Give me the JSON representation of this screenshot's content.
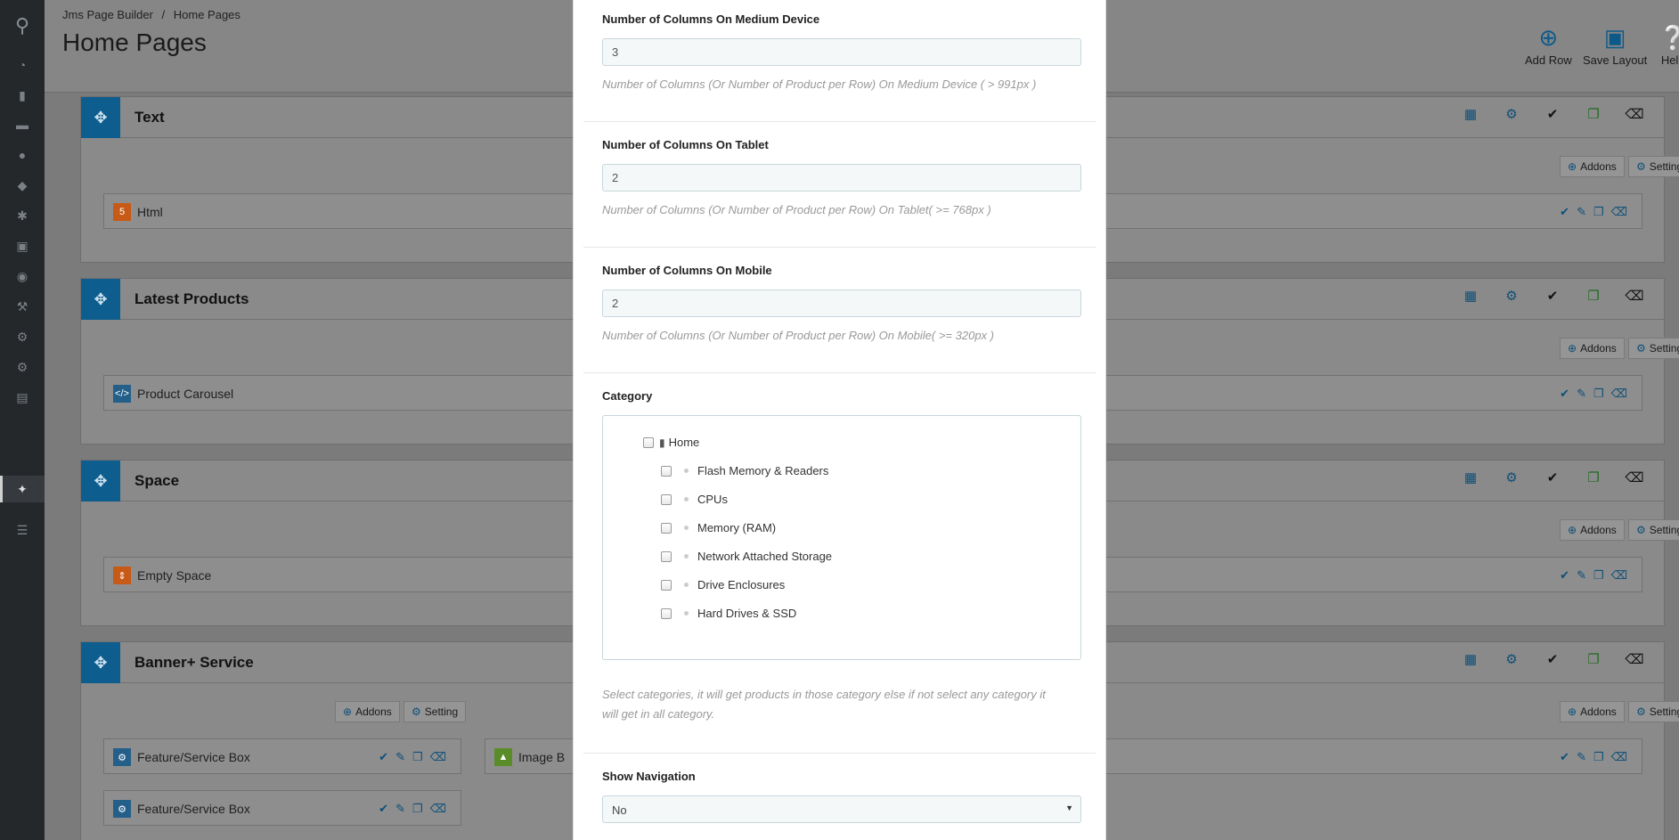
{
  "breadcrumb": [
    "Jms Page Builder",
    "/",
    "Home Pages"
  ],
  "page_title": "Home Pages",
  "header_buttons": [
    {
      "label": "Add Row",
      "icon": "plus-circle-icon"
    },
    {
      "label": "Save Layout",
      "icon": "save-icon"
    },
    {
      "label": "Help",
      "icon": "help-icon"
    }
  ],
  "rows": [
    {
      "title": "Text",
      "addons_label": "Addons",
      "setting_label": "Setting",
      "addon": {
        "name": "Html",
        "icon": "html5-icon"
      }
    },
    {
      "title": "Latest Products",
      "addons_label": "Addons",
      "setting_label": "Setting",
      "addon": {
        "name": "Product Carousel",
        "icon": "code-icon"
      }
    },
    {
      "title": "Space",
      "addons_label": "Addons",
      "setting_label": "Setting",
      "addon": {
        "name": "Empty Space",
        "icon": "arrows-v-icon"
      }
    },
    {
      "title": "Banner+ Service",
      "addons_label": "Addons",
      "setting_label": "Setting",
      "left_addons_label": "Addons",
      "left_setting_label": "Setting",
      "addons": [
        {
          "name": "Feature/Service Box",
          "icon": "feature-icon"
        },
        {
          "name": "Feature/Service Box",
          "icon": "feature-icon"
        },
        {
          "name": "Image B",
          "icon": "image-icon"
        }
      ]
    }
  ],
  "modal": {
    "medium": {
      "label": "Number of Columns On Medium Device",
      "value": "3",
      "help": "Number of Columns (Or Number of Product per Row) On Medium Device ( > 991px )"
    },
    "tablet": {
      "label": "Number of Columns On Tablet",
      "value": "2",
      "help": "Number of Columns (Or Number of Product per Row) On Tablet( >= 768px )"
    },
    "mobile": {
      "label": "Number of Columns On Mobile",
      "value": "2",
      "help": "Number of Columns (Or Number of Product per Row) On Mobile( >= 320px )"
    },
    "category": {
      "label": "Category",
      "root": "Home",
      "children": [
        "Flash Memory & Readers",
        "CPUs",
        "Memory (RAM)",
        "Network Attached Storage",
        "Drive Enclosures",
        "Hard Drives & SSD"
      ],
      "help_line1": "Select categories, it will get products in those category else if not select any category it",
      "help_line2": "will get in all category."
    },
    "navigation": {
      "label": "Show Navigation",
      "value": "No"
    }
  },
  "colors": {
    "accent": "#0e5d8f",
    "sidebar": "#25282b",
    "modal_bg": "#ffffff"
  }
}
